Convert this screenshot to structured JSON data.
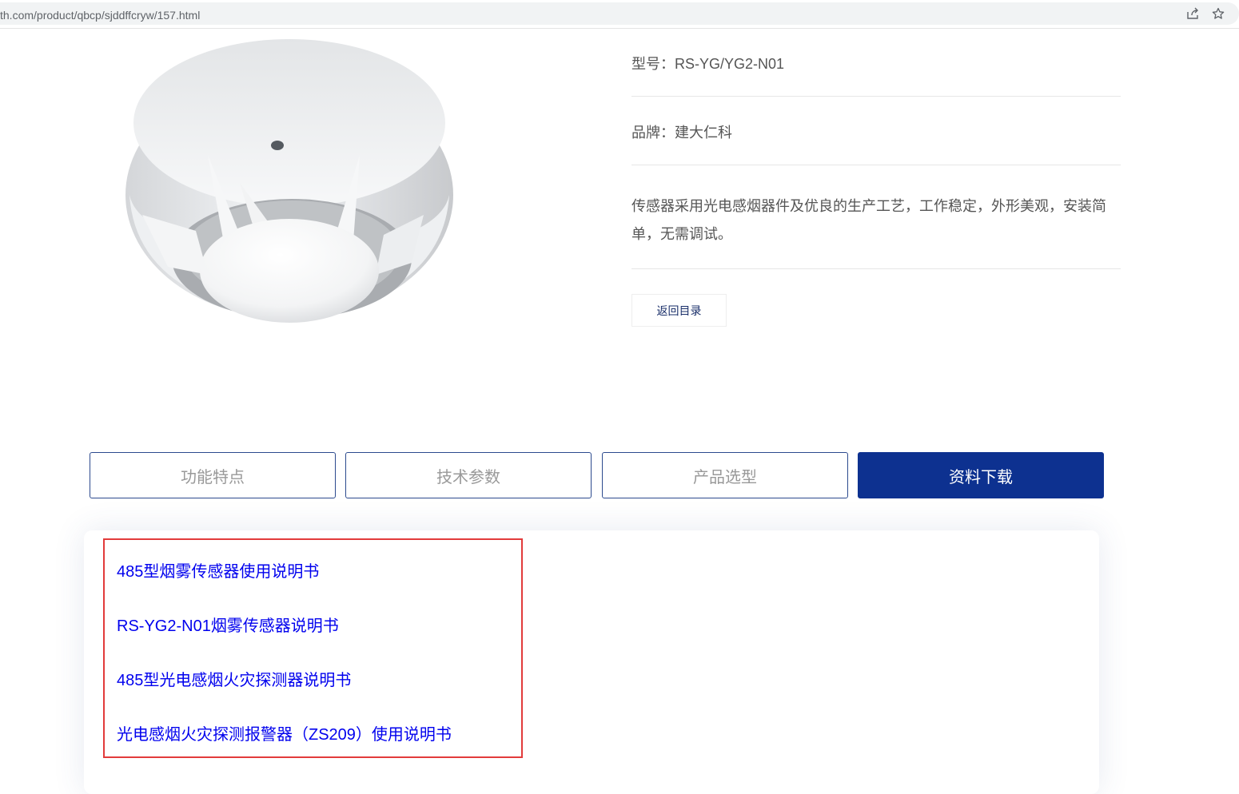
{
  "browser": {
    "url": "th.com/product/qbcp/sjddffcryw/157.html",
    "icons": [
      "share-icon",
      "star-icon"
    ]
  },
  "product": {
    "image_alt": "smoke-detector-image",
    "model_line": "型号：RS-YG/YG2-N01",
    "brand_line": "品牌：建大仁科",
    "description": "传感器采用光电感烟器件及优良的生产工艺，工作稳定，外形美观，安装简单，无需调试。",
    "back_label": "返回目录"
  },
  "tabs": [
    {
      "label": "功能特点",
      "active": false
    },
    {
      "label": "技术参数",
      "active": false
    },
    {
      "label": "产品选型",
      "active": false
    },
    {
      "label": "资料下载",
      "active": true
    }
  ],
  "downloads": [
    {
      "label": "485型烟雾传感器使用说明书"
    },
    {
      "label": "RS-YG2-N01烟雾传感器说明书"
    },
    {
      "label": "485型光电感烟火灾探测器说明书"
    },
    {
      "label": "光电感烟火灾探测报警器（ZS209）使用说明书"
    }
  ],
  "colors": {
    "accent": "#0d3190",
    "link": "#0000ee",
    "highlight_border": "#e23b3b"
  }
}
